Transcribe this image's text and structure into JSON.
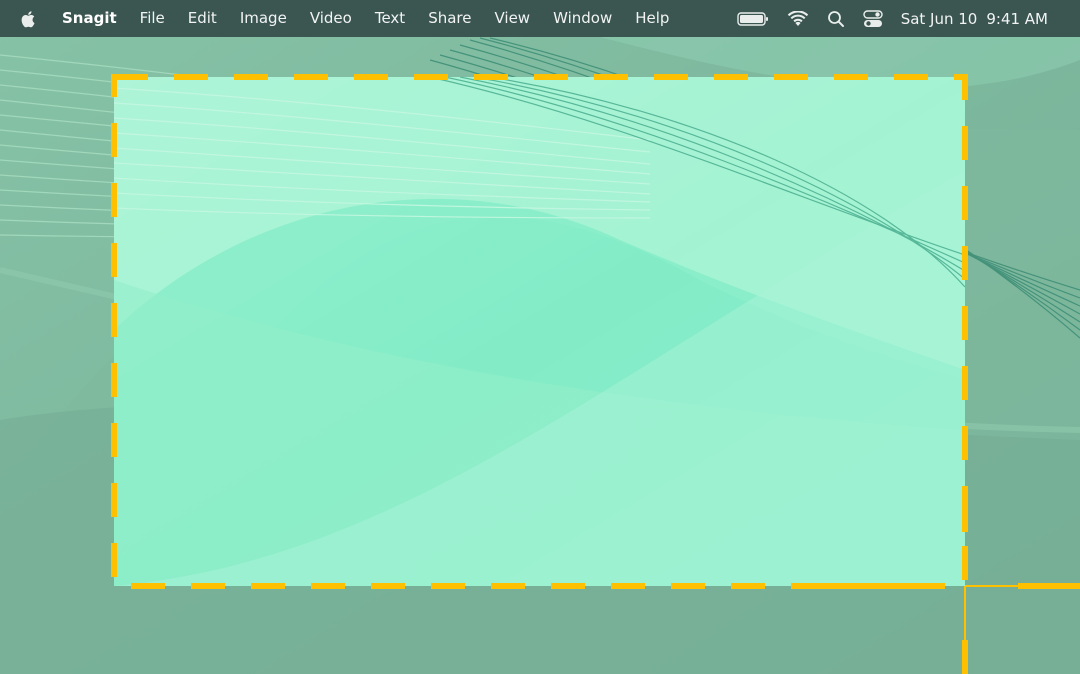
{
  "menubar": {
    "app_name": "Snagit",
    "items": [
      "File",
      "Edit",
      "Image",
      "Video",
      "Text",
      "Share",
      "View",
      "Window",
      "Help"
    ],
    "icons": [
      "apple-icon",
      "battery-icon",
      "wifi-icon",
      "search-icon",
      "control-center-icon"
    ],
    "date": "Sat Jun 10",
    "time": "9:41 AM"
  },
  "selection": {
    "border_color": "#ffc000",
    "style": "dashed"
  },
  "colors": {
    "menubar_bg": "#3b5551",
    "wallpaper_base": "#7bb59c",
    "selection_fill": "#a4f3d3"
  }
}
